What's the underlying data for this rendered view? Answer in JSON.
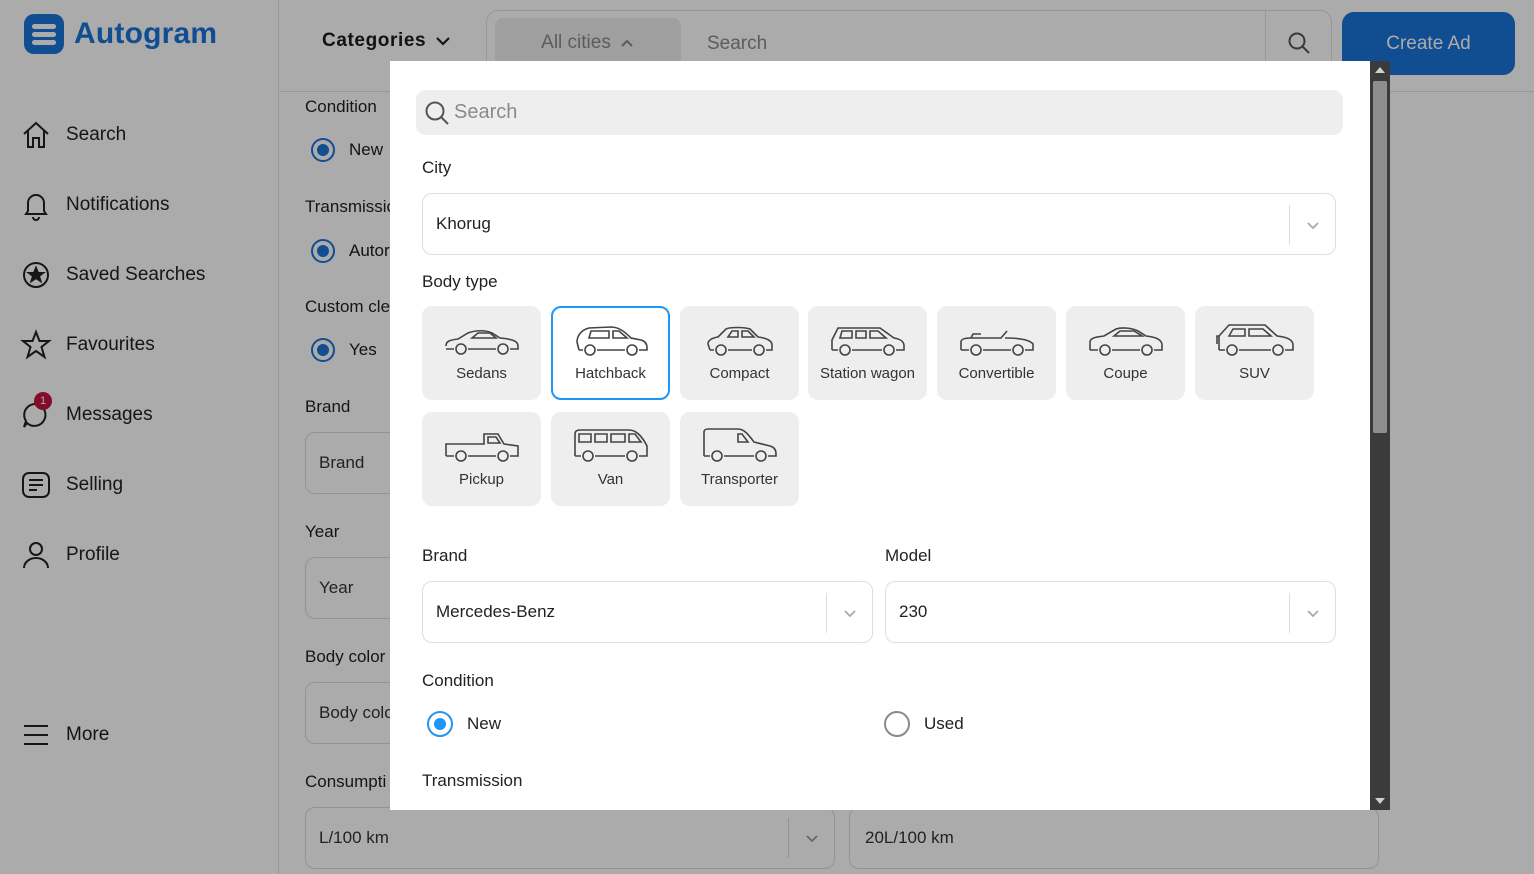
{
  "app": {
    "name": "Autogram"
  },
  "sidebar": {
    "items": [
      {
        "label": "Search",
        "icon": "home-icon"
      },
      {
        "label": "Notifications",
        "icon": "bell-icon"
      },
      {
        "label": "Saved Searches",
        "icon": "star-circle-icon"
      },
      {
        "label": "Favourites",
        "icon": "star-icon"
      },
      {
        "label": "Messages",
        "icon": "chat-icon",
        "badge": "1"
      },
      {
        "label": "Selling",
        "icon": "selling-icon"
      },
      {
        "label": "Profile",
        "icon": "user-icon"
      }
    ],
    "more_label": "More"
  },
  "topbar": {
    "categories_label": "Categories",
    "city_label": "All cities",
    "search_placeholder": "Search",
    "create_ad_label": "Create Ad"
  },
  "background_form": {
    "condition_label": "Condition",
    "condition_value": "New",
    "transmission_label": "Transmissio",
    "transmission_value": "Autor",
    "custom_label": "Custom cle",
    "custom_value": "Yes",
    "brand_label": "Brand",
    "brand_placeholder": "Brand",
    "year_label": "Year",
    "year_placeholder": "Year",
    "body_color_label": "Body color",
    "body_color_placeholder": "Body colo",
    "consumption_label": "Consumpti",
    "consumption_from": "L/100 km",
    "consumption_to": "20L/100 km"
  },
  "modal": {
    "search_placeholder": "Search",
    "city_label": "City",
    "city_value": "Khorug",
    "body_type_label": "Body type",
    "body_types": [
      {
        "label": "Sedans",
        "selected": false
      },
      {
        "label": "Hatchback",
        "selected": true
      },
      {
        "label": "Compact",
        "selected": false
      },
      {
        "label": "Station wagon",
        "selected": false
      },
      {
        "label": "Convertible",
        "selected": false
      },
      {
        "label": "Coupe",
        "selected": false
      },
      {
        "label": "SUV",
        "selected": false
      },
      {
        "label": "Pickup",
        "selected": false
      },
      {
        "label": "Van",
        "selected": false
      },
      {
        "label": "Transporter",
        "selected": false
      }
    ],
    "brand_label": "Brand",
    "brand_value": "Mercedes-Benz",
    "model_label": "Model",
    "model_value": "230",
    "condition_label": "Condition",
    "condition_options": [
      {
        "label": "New",
        "checked": true
      },
      {
        "label": "Used",
        "checked": false
      }
    ],
    "transmission_label": "Transmission"
  },
  "colors": {
    "brand": "#1a73d9",
    "selected_border": "#2196f3",
    "badge": "#c0143c"
  }
}
